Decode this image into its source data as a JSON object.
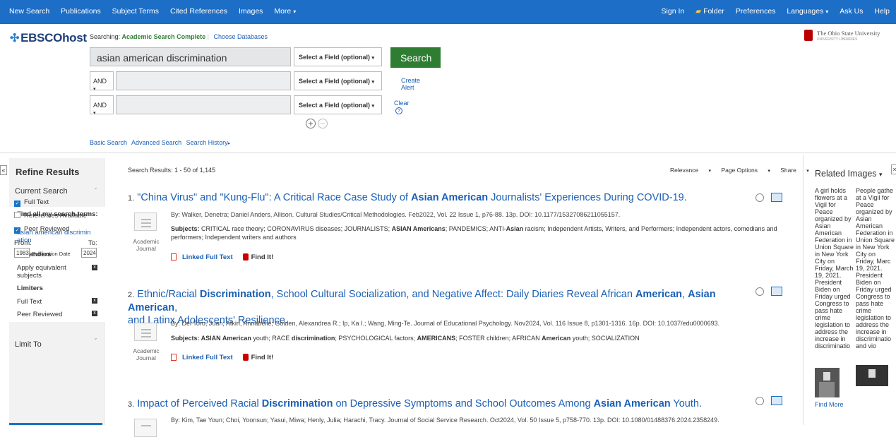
{
  "topnav": {
    "left": [
      "New Search",
      "Publications",
      "Subject Terms",
      "Cited References",
      "Images",
      "More"
    ],
    "right": [
      "Sign In",
      "Folder",
      "Preferences",
      "Languages",
      "Ask Us",
      "Help"
    ]
  },
  "header": {
    "logo": "EBSCOhost",
    "searching_label": "Searching:",
    "database": "Academic Search Complete",
    "choose_db": "Choose Databases",
    "institution": "The Ohio State University",
    "institution_sub": "UNIVERSITY LIBRARIES"
  },
  "search": {
    "query": "asian american discrimination",
    "field_select": "Select a Field (optional)",
    "bool": "AND",
    "search_button": "Search",
    "create_alert": "Create Alert",
    "clear": "Clear",
    "help_glyph": "?",
    "plus": "+",
    "minus": "−",
    "links": [
      "Basic Search",
      "Advanced Search",
      "Search History"
    ]
  },
  "sidebar": {
    "title": "Refine Results",
    "current_search": "Current Search",
    "find_all": "Find all my search terms:",
    "query_text": "asian american discrimin ation",
    "expanders": "Expanders",
    "apply_equiv": "Apply equivalent subjects",
    "limiters": "Limiters",
    "full_text": "Full Text",
    "peer_reviewed": "Peer Reviewed",
    "limit_to": "Limit To",
    "limit_items": [
      "Full Text",
      "References Available",
      "Peer Reviewed"
    ],
    "limit_checked": [
      true,
      false,
      true
    ],
    "from_label": "From:",
    "to_label": "To:",
    "from_year": "1983",
    "to_year": "2024",
    "pub_date": "Publication Date",
    "remove_glyph": "x",
    "collapse_glyph": "«"
  },
  "results": {
    "header_prefix": "Search Results:",
    "range": "1 - 50 of 1,145",
    "sort": [
      "Relevance",
      "Page Options",
      "Share"
    ],
    "items": [
      {
        "num": "1.",
        "title_parts": [
          "\"China Virus\" and \"Kung-Flu\": A Critical Race Case Study of ",
          "Asian American",
          " Journalists' Experiences During COVID-19."
        ],
        "meta": "By: Walker, Denetra; Daniel Anders, Allison. Cultural Studies/Critical Methodologies. Feb2022, Vol. 22 Issue 1, p76-88. 13p. DOI: 10.1177/15327086211055157.",
        "subj_label": "Subjects:",
        "subj_a": " CRITICAL race theory; CORONAVIRUS diseases; JOURNALISTS; ",
        "subj_b": "ASIAN Americans",
        "subj_c": "; PANDEMICS; ANTI-",
        "subj_d": "Asian",
        "subj_e": " racism; Independent Artists, Writers, and Performers; Independent actors, comedians and performers; Independent writers and authors",
        "type": "Academic Journal",
        "full_text": "Linked Full Text",
        "find_it": "Find It!"
      },
      {
        "num": "2.",
        "title_a": "Ethnic/Racial ",
        "title_b": "Discrimination",
        "title_c": ", School Cultural Socialization, and Negative Affect: Daily Diaries Reveal African ",
        "title_d": "American",
        "title_e": ", ",
        "title_f": "Asian American",
        "title_g": ",",
        "title_line2": "and Latinx Adolescents' Resilience.",
        "meta": "By: Del Toro, Juan; Atkin, Annabelle; Golden, Alexandrea R.; Ip, Ka I.; Wang, Ming-Te. Journal of Educational Psychology. Nov2024, Vol. 116 Issue 8, p1301-1316. 16p. DOI: 10.1037/edu0000693.",
        "subj_label": "Subjects:",
        "subj_a": " ASIAN American",
        "subj_b": " youth; RACE ",
        "subj_c": "discrimination",
        "subj_d": "; PSYCHOLOGICAL factors; ",
        "subj_e": "AMERICANS",
        "subj_f": "; FOSTER children; AFRICAN ",
        "subj_g": "American",
        "subj_h": " youth; SOCIALIZATION",
        "type": "Academic Journal",
        "full_text": "Linked Full Text",
        "find_it": "Find It!"
      },
      {
        "num": "3.",
        "title_a": "Impact of Perceived Racial ",
        "title_b": "Discrimination",
        "title_c": " on Depressive Symptoms and School Outcomes Among ",
        "title_d": "Asian American",
        "title_e": " Youth.",
        "meta": "By: Kim, Tae Youn; Choi, Yoonsun; Yasui, Miwa; Henly, Julia; Harachi, Tracy. Journal of Social Service Research. Oct2024, Vol. 50 Issue 5, p758-770. 13p. DOI: 10.1080/01488376.2024.2358249."
      }
    ]
  },
  "related": {
    "title": "Related Images",
    "col1": "A girl holds flowers at a Vigil for Peace organized by Asian American Federation in Union Square in New York City on Friday, March 19, 2021. President Biden on Friday urged Congress to pass hate crime legislation to address the increase in discriminatio",
    "col2": "People gathe at a Vigil for Peace organized by Asian American Federation in Union Square in New York City on Friday, Marc 19, 2021. President Biden on Friday urged Congress to pass hate crime legislation to address the increase in discriminatio and vio",
    "find_more": "Find More",
    "close_glyph": "×"
  }
}
